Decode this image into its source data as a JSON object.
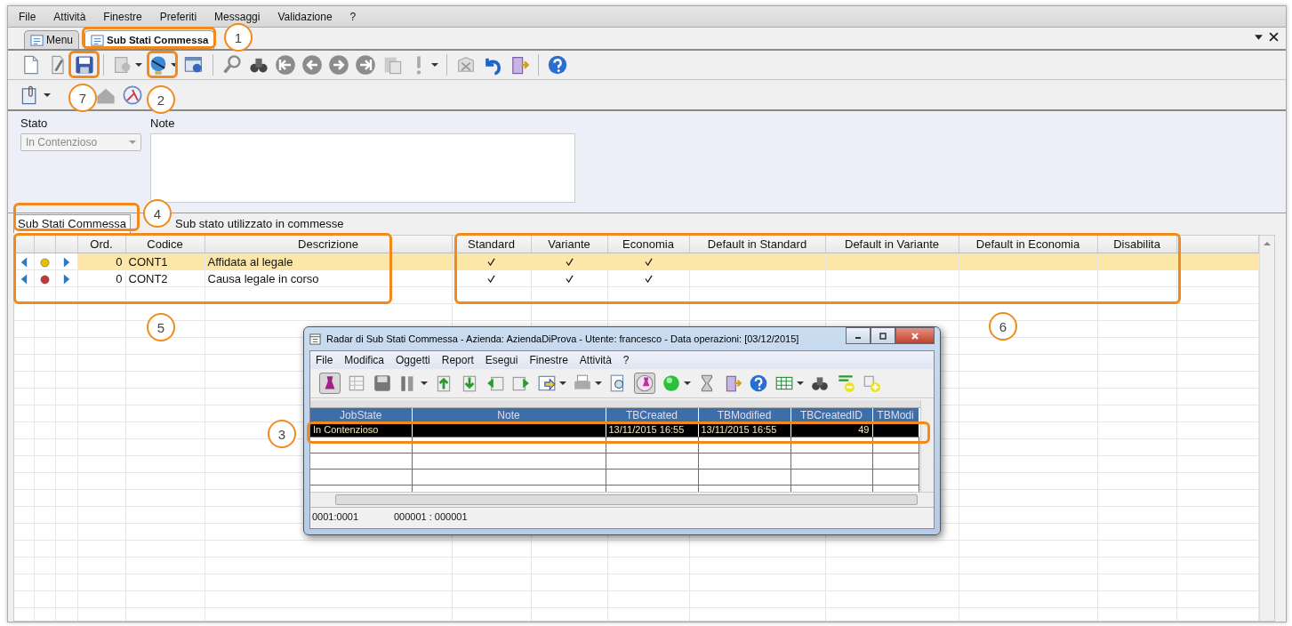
{
  "menu": [
    "File",
    "Attività",
    "Finestre",
    "Preferiti",
    "Messaggi",
    "Validazione",
    "?"
  ],
  "tabs": [
    {
      "label": "Menu",
      "selected": false
    },
    {
      "label": "Sub Stati Commessa",
      "selected": true
    }
  ],
  "form": {
    "stato": {
      "label": "Stato",
      "value": "In Contenzioso",
      "disabled": true
    },
    "note": {
      "label": "Note"
    }
  },
  "sub_tabs": [
    {
      "label": "Sub Stati Commessa",
      "selected": true
    },
    {
      "label": "Sub stato utilizzato in commesse",
      "selected": false
    }
  ],
  "grid": {
    "columns": [
      "Ord.",
      "Codice",
      "Descrizione",
      "Standard",
      "Variante",
      "Economia",
      "Default in Standard",
      "Default in Variante",
      "Default in Economia",
      "Disabilita"
    ],
    "rows": [
      {
        "selected": true,
        "color": "#e8c000",
        "ord": "0",
        "codice": "CONT1",
        "descrizione": "Affidata al legale",
        "standard": true,
        "variante": true,
        "economia": true
      },
      {
        "selected": false,
        "color": "#c83434",
        "ord": "0",
        "codice": "CONT2",
        "descrizione": "Causa legale in corso",
        "standard": true,
        "variante": true,
        "economia": true
      }
    ]
  },
  "radar": {
    "title": "Radar di Sub Stati Commessa - Azienda: AziendaDiProva - Utente: francesco - Data operazioni: [03/12/2015]",
    "menu": [
      "File",
      "Modifica",
      "Oggetti",
      "Report",
      "Esegui",
      "Finestre",
      "Attività",
      "?"
    ],
    "columns": [
      "JobState",
      "Note",
      "TBCreated",
      "TBModified",
      "TBCreatedID",
      "TBModi"
    ],
    "rows": [
      {
        "selected": true,
        "job_state": "In Contenzioso",
        "tb_created": "13/11/2015 16:55",
        "tb_modified": "13/11/2015 16:55",
        "tb_created_id": "49"
      }
    ],
    "status": [
      "0001:0001",
      "000001 : 000001"
    ]
  },
  "callouts": [
    "1",
    "7",
    "2",
    "4",
    "5",
    "6",
    "3"
  ]
}
